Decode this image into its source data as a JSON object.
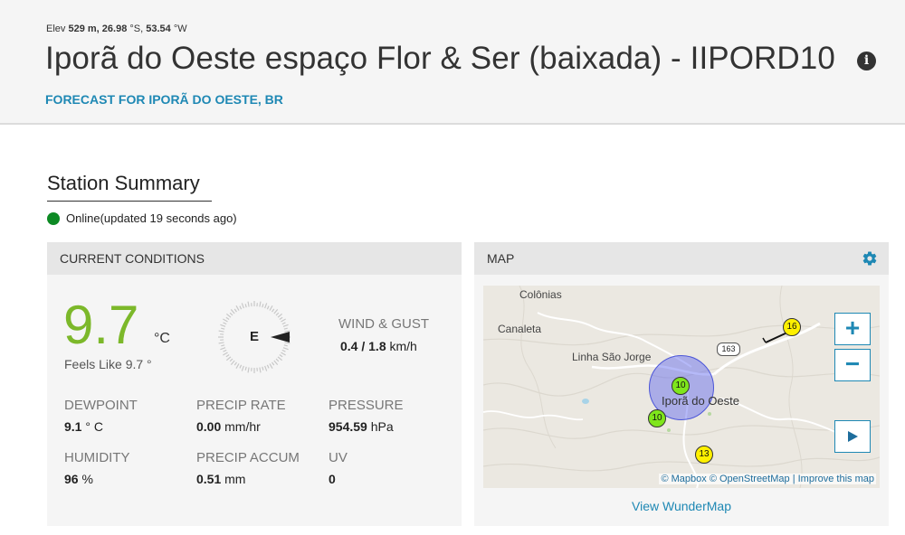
{
  "header": {
    "elev_prefix": "Elev",
    "elev_value": "529 m,",
    "lat_value": "26.98",
    "lat_unit": "°S,",
    "lon_value": "53.54",
    "lon_unit": "°W",
    "title": "Iporã do Oeste espaço Flor & Ser (baixada) - IIPORD10",
    "forecast_link": "FORECAST FOR IPORÃ DO OESTE, BR"
  },
  "summary": {
    "title": "Station Summary",
    "status_text": "Online(updated 19 seconds ago)",
    "status_color": "#0d8a24"
  },
  "current_conditions": {
    "header": "CURRENT CONDITIONS",
    "temperature": "9.7",
    "temperature_unit": "°C",
    "feels_like": "Feels Like 9.7 °",
    "wind_direction": "E",
    "wind_label": "WIND & GUST",
    "wind_speed": "0.4",
    "wind_gust": "/ 1.8",
    "wind_unit": "km/h",
    "dewpoint_label": "DEWPOINT",
    "dewpoint_value": "9.1",
    "dewpoint_unit": "° C",
    "precip_rate_label": "PRECIP RATE",
    "precip_rate_value": "0.00",
    "precip_rate_unit": "mm/hr",
    "pressure_label": "PRESSURE",
    "pressure_value": "954.59",
    "pressure_unit": "hPa",
    "humidity_label": "HUMIDITY",
    "humidity_value": "96",
    "humidity_unit": "%",
    "precip_accum_label": "PRECIP ACCUM",
    "precip_accum_value": "0.51",
    "precip_accum_unit": "mm",
    "uv_label": "UV",
    "uv_value": "0",
    "temp_color": "#7cb82a"
  },
  "map": {
    "header": "MAP",
    "places": [
      "Colônias",
      "Canaleta",
      "Linha São Jorge",
      "Iporã do Oeste"
    ],
    "road_shield": "163",
    "markers": [
      "10",
      "10",
      "13",
      "16"
    ],
    "zoom_in": "+",
    "zoom_out": "−",
    "attribution_mapbox": "© Mapbox",
    "attribution_osm": "© OpenStreetMap",
    "attribution_sep": "|",
    "attribution_improve": "Improve this map",
    "view_link": "View WunderMap"
  }
}
